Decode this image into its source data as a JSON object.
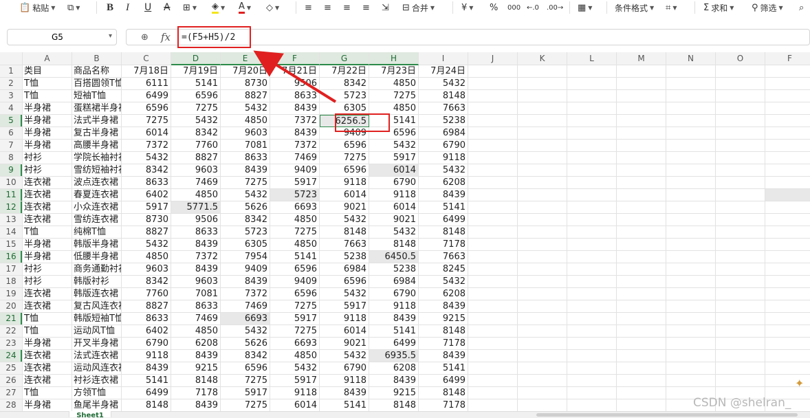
{
  "toolbar": {
    "paste_label": "粘贴",
    "merge_label": "合并",
    "currency_glyph": "¥",
    "percent_glyph": "%",
    "thousands_glyph": "000",
    "cond_format_label": "条件格式",
    "sum_label": "求和",
    "filter_label": "筛选",
    "font_color": "#e02020",
    "fill_color": "#f5e51b"
  },
  "formula_bar": {
    "cell_ref": "G5",
    "fx": "fx",
    "formula": "=(F5+H5)/2"
  },
  "columns": [
    "A",
    "B",
    "C",
    "D",
    "E",
    "F",
    "G",
    "H",
    "I",
    "J",
    "K",
    "L",
    "M",
    "N",
    "O",
    "F"
  ],
  "rows": [
    [
      "类目",
      "商品名称",
      "7月18日",
      "7月19日",
      "7月20日",
      "7月21日",
      "7月22日",
      "7月23日",
      "7月24日"
    ],
    [
      "T恤",
      "百搭圆领T恤",
      "6111",
      "5141",
      "8730",
      "9506",
      "8342",
      "4850",
      "5432"
    ],
    [
      "T恤",
      "短袖T恤",
      "6499",
      "6596",
      "8827",
      "8633",
      "5723",
      "7275",
      "8148"
    ],
    [
      "半身裙",
      "蛋糕裙半身裙",
      "6596",
      "7275",
      "5432",
      "8439",
      "6305",
      "4850",
      "7663"
    ],
    [
      "半身裙",
      "法式半身裙",
      "7275",
      "5432",
      "4850",
      "7372",
      "6256.5",
      "5141",
      "5238"
    ],
    [
      "半身裙",
      "复古半身裙",
      "6014",
      "8342",
      "9603",
      "8439",
      "9409",
      "6596",
      "6984"
    ],
    [
      "半身裙",
      "高腰半身裙",
      "7372",
      "7760",
      "7081",
      "7372",
      "6596",
      "5432",
      "6790"
    ],
    [
      "衬衫",
      "学院长袖衬衫",
      "5432",
      "8827",
      "8633",
      "7469",
      "7275",
      "5917",
      "9118"
    ],
    [
      "衬衫",
      "雪纺短袖衬衫",
      "8342",
      "9603",
      "8439",
      "9409",
      "6596",
      "6014",
      "5432"
    ],
    [
      "连衣裙",
      "波点连衣裙",
      "8633",
      "7469",
      "7275",
      "5917",
      "9118",
      "6790",
      "6208"
    ],
    [
      "连衣裙",
      "春夏连衣裙",
      "6402",
      "4850",
      "5432",
      "5723",
      "6014",
      "9118",
      "8439"
    ],
    [
      "连衣裙",
      "小众连衣裙",
      "5917",
      "5771.5",
      "5626",
      "6693",
      "9021",
      "6014",
      "5141"
    ],
    [
      "连衣裙",
      "雪纺连衣裙",
      "8730",
      "9506",
      "8342",
      "4850",
      "5432",
      "9021",
      "6499"
    ],
    [
      "T恤",
      "纯棉T恤",
      "8827",
      "8633",
      "5723",
      "7275",
      "8148",
      "5432",
      "8148"
    ],
    [
      "半身裙",
      "韩版半身裙",
      "5432",
      "8439",
      "6305",
      "4850",
      "7663",
      "8148",
      "7178"
    ],
    [
      "半身裙",
      "低腰半身裙",
      "4850",
      "7372",
      "7954",
      "5141",
      "5238",
      "6450.5",
      "7663"
    ],
    [
      "衬衫",
      "商务通勤衬衫",
      "9603",
      "8439",
      "9409",
      "6596",
      "6984",
      "5238",
      "8245"
    ],
    [
      "衬衫",
      "韩版衬衫",
      "8342",
      "9603",
      "8439",
      "9409",
      "6596",
      "6984",
      "5432"
    ],
    [
      "连衣裙",
      "韩版连衣裙",
      "7760",
      "7081",
      "7372",
      "6596",
      "5432",
      "6790",
      "6208"
    ],
    [
      "连衣裙",
      "复古风连衣裙",
      "8827",
      "8633",
      "7469",
      "7275",
      "5917",
      "9118",
      "8439"
    ],
    [
      "T恤",
      "韩版短袖T恤",
      "8633",
      "7469",
      "6693",
      "5917",
      "9118",
      "8439",
      "9215"
    ],
    [
      "T恤",
      "运动风T恤",
      "6402",
      "4850",
      "5432",
      "7275",
      "6014",
      "5141",
      "8148"
    ],
    [
      "半身裙",
      "开叉半身裙",
      "6790",
      "6208",
      "5626",
      "6693",
      "9021",
      "6499",
      "7178"
    ],
    [
      "连衣裙",
      "法式连衣裙",
      "9118",
      "8439",
      "8342",
      "4850",
      "5432",
      "6935.5",
      "8439"
    ],
    [
      "连衣裙",
      "运动风连衣裙",
      "8439",
      "9215",
      "6596",
      "5432",
      "6790",
      "6208",
      "5141"
    ],
    [
      "连衣裙",
      "衬衫连衣裙",
      "5141",
      "8148",
      "7275",
      "5917",
      "9118",
      "8439",
      "6499"
    ],
    [
      "T恤",
      "方领T恤",
      "6499",
      "7178",
      "5917",
      "9118",
      "8439",
      "9215",
      "8148"
    ],
    [
      "半身裙",
      "鱼尾半身裙",
      "8148",
      "8439",
      "7275",
      "6014",
      "5141",
      "8148",
      "7178"
    ]
  ],
  "highlighted_cells": [
    "H9",
    "F11",
    "D12",
    "H16",
    "E21",
    "H24"
  ],
  "selected_rows": [
    5,
    9,
    11,
    12,
    16,
    21,
    24
  ],
  "selected_cols": [
    "D",
    "E",
    "F",
    "G",
    "H"
  ],
  "active_cell": "G5",
  "sheet_tab": "Sheet1",
  "watermark": "CSDN @shelran_"
}
